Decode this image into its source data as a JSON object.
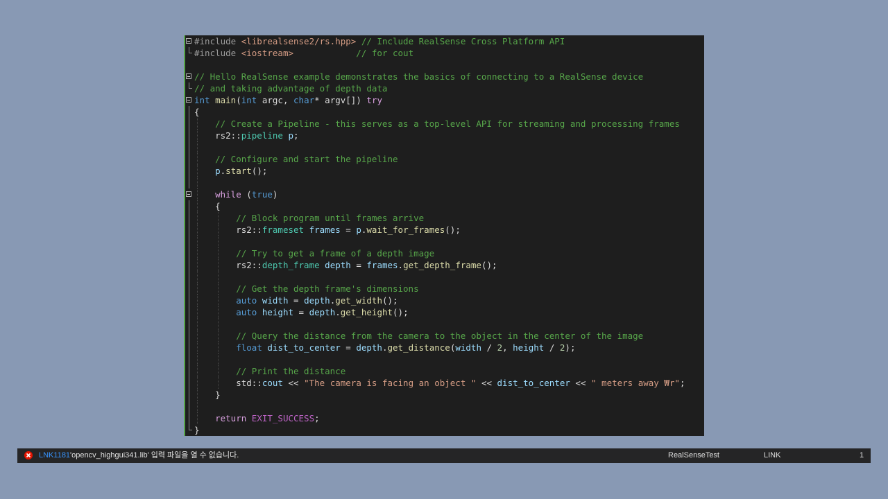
{
  "editor": {
    "lines": [
      {
        "fold": "box",
        "indent": 0,
        "tokens": [
          {
            "t": "#include ",
            "c": "prep"
          },
          {
            "t": "<librealsense2/rs.hpp>",
            "c": "inc"
          },
          {
            "t": " // Include RealSense Cross Platform API",
            "c": "com"
          }
        ]
      },
      {
        "fold": "end",
        "indent": 0,
        "tokens": [
          {
            "t": "#include ",
            "c": "prep"
          },
          {
            "t": "<iostream>",
            "c": "inc"
          },
          {
            "t": "            // for cout",
            "c": "com"
          }
        ]
      },
      {
        "fold": "none",
        "indent": 0,
        "tokens": []
      },
      {
        "fold": "box",
        "indent": 0,
        "tokens": [
          {
            "t": "// Hello RealSense example demonstrates the basics of connecting to a RealSense device",
            "c": "com"
          }
        ]
      },
      {
        "fold": "end",
        "indent": 0,
        "tokens": [
          {
            "t": "// and taking advantage of depth data",
            "c": "com"
          }
        ]
      },
      {
        "fold": "box",
        "indent": 0,
        "tokens": [
          {
            "t": "int",
            "c": "kw"
          },
          {
            "t": " ",
            "c": "pl"
          },
          {
            "t": "main",
            "c": "fn"
          },
          {
            "t": "(",
            "c": "pl"
          },
          {
            "t": "int",
            "c": "kw"
          },
          {
            "t": " argc, ",
            "c": "pl"
          },
          {
            "t": "char",
            "c": "kw"
          },
          {
            "t": "* argv[]) ",
            "c": "pl"
          },
          {
            "t": "try",
            "c": "ctl"
          }
        ]
      },
      {
        "fold": "line",
        "indent": 0,
        "tokens": [
          {
            "t": "{",
            "c": "pl"
          }
        ]
      },
      {
        "fold": "line",
        "indent": 1,
        "tokens": [
          {
            "t": "    // Create a Pipeline - this serves as a top-level API for streaming and processing frames",
            "c": "com"
          }
        ]
      },
      {
        "fold": "line",
        "indent": 1,
        "tokens": [
          {
            "t": "    rs2::",
            "c": "pl"
          },
          {
            "t": "pipeline",
            "c": "type"
          },
          {
            "t": " ",
            "c": "pl"
          },
          {
            "t": "p",
            "c": "var"
          },
          {
            "t": ";",
            "c": "pl"
          }
        ]
      },
      {
        "fold": "line",
        "indent": 1,
        "tokens": []
      },
      {
        "fold": "line",
        "indent": 1,
        "tokens": [
          {
            "t": "    // Configure and start the pipeline",
            "c": "com"
          }
        ]
      },
      {
        "fold": "line",
        "indent": 1,
        "tokens": [
          {
            "t": "    ",
            "c": "pl"
          },
          {
            "t": "p",
            "c": "var"
          },
          {
            "t": ".",
            "c": "pl"
          },
          {
            "t": "start",
            "c": "fn"
          },
          {
            "t": "();",
            "c": "pl"
          }
        ]
      },
      {
        "fold": "line",
        "indent": 1,
        "tokens": []
      },
      {
        "fold": "box",
        "indent": 1,
        "tokens": [
          {
            "t": "    ",
            "c": "pl"
          },
          {
            "t": "while",
            "c": "ctl"
          },
          {
            "t": " (",
            "c": "pl"
          },
          {
            "t": "true",
            "c": "kw"
          },
          {
            "t": ")",
            "c": "pl"
          }
        ]
      },
      {
        "fold": "line",
        "indent": 1,
        "tokens": [
          {
            "t": "    {",
            "c": "pl"
          }
        ]
      },
      {
        "fold": "line",
        "indent": 2,
        "tokens": [
          {
            "t": "        // Block program until frames arrive",
            "c": "com"
          }
        ]
      },
      {
        "fold": "line",
        "indent": 2,
        "tokens": [
          {
            "t": "        rs2::",
            "c": "pl"
          },
          {
            "t": "frameset",
            "c": "type"
          },
          {
            "t": " ",
            "c": "pl"
          },
          {
            "t": "frames",
            "c": "var"
          },
          {
            "t": " = ",
            "c": "pl"
          },
          {
            "t": "p",
            "c": "var"
          },
          {
            "t": ".",
            "c": "pl"
          },
          {
            "t": "wait_for_frames",
            "c": "fn"
          },
          {
            "t": "();",
            "c": "pl"
          }
        ]
      },
      {
        "fold": "line",
        "indent": 2,
        "tokens": []
      },
      {
        "fold": "line",
        "indent": 2,
        "tokens": [
          {
            "t": "        // Try to get a frame of a depth image",
            "c": "com"
          }
        ]
      },
      {
        "fold": "line",
        "indent": 2,
        "tokens": [
          {
            "t": "        rs2::",
            "c": "pl"
          },
          {
            "t": "depth_frame",
            "c": "type"
          },
          {
            "t": " ",
            "c": "pl"
          },
          {
            "t": "depth",
            "c": "var"
          },
          {
            "t": " = ",
            "c": "pl"
          },
          {
            "t": "frames",
            "c": "var"
          },
          {
            "t": ".",
            "c": "pl"
          },
          {
            "t": "get_depth_frame",
            "c": "fn"
          },
          {
            "t": "();",
            "c": "pl"
          }
        ]
      },
      {
        "fold": "line",
        "indent": 2,
        "tokens": []
      },
      {
        "fold": "line",
        "indent": 2,
        "tokens": [
          {
            "t": "        // Get the depth frame's dimensions",
            "c": "com"
          }
        ]
      },
      {
        "fold": "line",
        "indent": 2,
        "tokens": [
          {
            "t": "        ",
            "c": "pl"
          },
          {
            "t": "auto",
            "c": "kw"
          },
          {
            "t": " ",
            "c": "pl"
          },
          {
            "t": "width",
            "c": "var"
          },
          {
            "t": " = ",
            "c": "pl"
          },
          {
            "t": "depth",
            "c": "var"
          },
          {
            "t": ".",
            "c": "pl"
          },
          {
            "t": "get_width",
            "c": "fn"
          },
          {
            "t": "();",
            "c": "pl"
          }
        ]
      },
      {
        "fold": "line",
        "indent": 2,
        "tokens": [
          {
            "t": "        ",
            "c": "pl"
          },
          {
            "t": "auto",
            "c": "kw"
          },
          {
            "t": " ",
            "c": "pl"
          },
          {
            "t": "height",
            "c": "var"
          },
          {
            "t": " = ",
            "c": "pl"
          },
          {
            "t": "depth",
            "c": "var"
          },
          {
            "t": ".",
            "c": "pl"
          },
          {
            "t": "get_height",
            "c": "fn"
          },
          {
            "t": "();",
            "c": "pl"
          }
        ]
      },
      {
        "fold": "line",
        "indent": 2,
        "tokens": []
      },
      {
        "fold": "line",
        "indent": 2,
        "tokens": [
          {
            "t": "        // Query the distance from the camera to the object in the center of the image",
            "c": "com"
          }
        ]
      },
      {
        "fold": "line",
        "indent": 2,
        "tokens": [
          {
            "t": "        ",
            "c": "pl"
          },
          {
            "t": "float",
            "c": "kw"
          },
          {
            "t": " ",
            "c": "pl"
          },
          {
            "t": "dist_to_center",
            "c": "var"
          },
          {
            "t": " = ",
            "c": "pl"
          },
          {
            "t": "depth",
            "c": "var"
          },
          {
            "t": ".",
            "c": "pl"
          },
          {
            "t": "get_distance",
            "c": "fn"
          },
          {
            "t": "(",
            "c": "pl"
          },
          {
            "t": "width",
            "c": "var"
          },
          {
            "t": " / ",
            "c": "pl"
          },
          {
            "t": "2",
            "c": "num"
          },
          {
            "t": ", ",
            "c": "pl"
          },
          {
            "t": "height",
            "c": "var"
          },
          {
            "t": " / ",
            "c": "pl"
          },
          {
            "t": "2",
            "c": "num"
          },
          {
            "t": ");",
            "c": "pl"
          }
        ]
      },
      {
        "fold": "line",
        "indent": 2,
        "tokens": []
      },
      {
        "fold": "line",
        "indent": 2,
        "tokens": [
          {
            "t": "        // Print the distance",
            "c": "com"
          }
        ]
      },
      {
        "fold": "line",
        "indent": 2,
        "tokens": [
          {
            "t": "        std::",
            "c": "pl"
          },
          {
            "t": "cout",
            "c": "var"
          },
          {
            "t": " << ",
            "c": "pl"
          },
          {
            "t": "\"The camera is facing an object \"",
            "c": "str"
          },
          {
            "t": " << ",
            "c": "pl"
          },
          {
            "t": "dist_to_center",
            "c": "var"
          },
          {
            "t": " << ",
            "c": "pl"
          },
          {
            "t": "\" meters away ₩r\"",
            "c": "str"
          },
          {
            "t": ";",
            "c": "pl"
          }
        ]
      },
      {
        "fold": "line",
        "indent": 1,
        "tokens": [
          {
            "t": "    }",
            "c": "pl"
          }
        ]
      },
      {
        "fold": "line",
        "indent": 1,
        "tokens": []
      },
      {
        "fold": "line",
        "indent": 1,
        "tokens": [
          {
            "t": "    ",
            "c": "pl"
          },
          {
            "t": "return",
            "c": "ctl"
          },
          {
            "t": " ",
            "c": "pl"
          },
          {
            "t": "EXIT_SUCCESS",
            "c": "mac"
          },
          {
            "t": ";",
            "c": "pl"
          }
        ]
      },
      {
        "fold": "end",
        "indent": 0,
        "tokens": [
          {
            "t": "}",
            "c": "pl"
          }
        ]
      }
    ]
  },
  "error_list": {
    "icon": "error-circle-icon",
    "code": "LNK1181",
    "message": "'opencv_highgui341.lib' 입력 파일을 열 수 없습니다.",
    "project": "RealSenseTest",
    "file": "LINK",
    "line": "1"
  }
}
